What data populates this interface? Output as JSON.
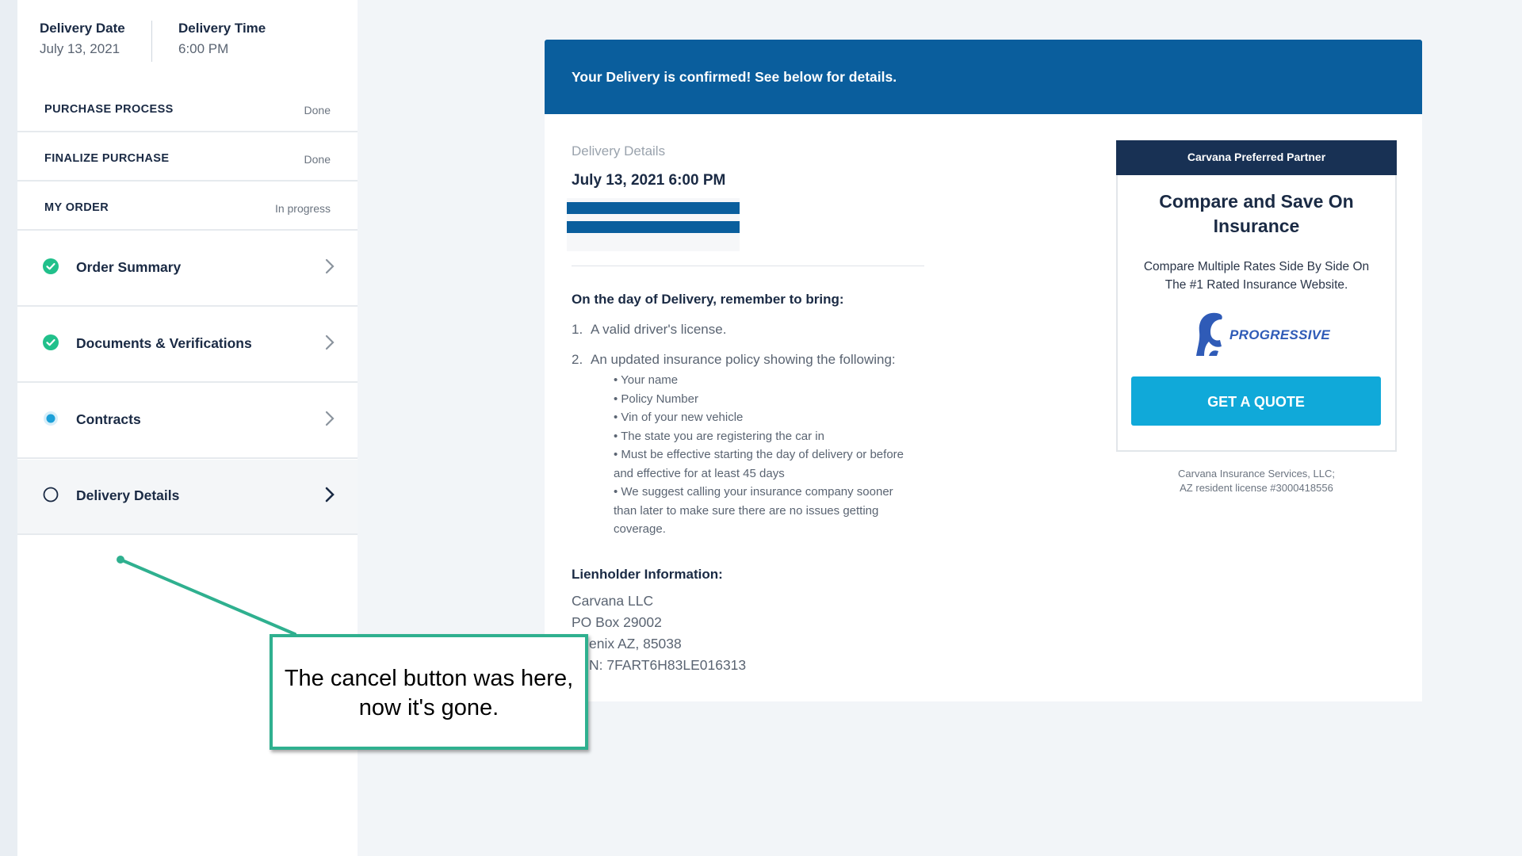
{
  "sidebar": {
    "delivery_date_label": "Delivery Date",
    "delivery_date_value": "July 13, 2021",
    "delivery_time_label": "Delivery Time",
    "delivery_time_value": "6:00 PM",
    "steps": [
      {
        "label": "PURCHASE PROCESS",
        "status": "Done"
      },
      {
        "label": "FINALIZE PURCHASE",
        "status": "Done"
      },
      {
        "label": "MY ORDER",
        "status": "In progress"
      }
    ],
    "substeps": [
      {
        "label": "Order Summary",
        "state": "complete"
      },
      {
        "label": "Documents & Verifications",
        "state": "complete"
      },
      {
        "label": "Contracts",
        "state": "current"
      },
      {
        "label": "Delivery Details",
        "state": "pending"
      }
    ]
  },
  "banner": {
    "text": "Your Delivery is confirmed! See below for details."
  },
  "details": {
    "label": "Delivery Details",
    "datetime": "July 13, 2021 6:00 PM",
    "bring_heading": "On the day of Delivery, remember to bring:",
    "items": [
      {
        "num": "1.",
        "text": "A valid driver's license."
      },
      {
        "num": "2.",
        "text": "An updated insurance policy showing the following:"
      }
    ],
    "bullets": [
      "• Your name",
      "• Policy Number",
      "• Vin of your new vehicle",
      "• The state you are registering the car in",
      "• Must be effective starting the day of delivery or before and effective for at least 45 days",
      "• We suggest calling your insurance company sooner than later to make sure there are no issues getting coverage."
    ],
    "lien_heading": "Lienholder Information:",
    "lien_lines": [
      "Carvana LLC",
      "PO Box 29002",
      "enix AZ, 85038",
      "N: 7FART6H83LE016313"
    ]
  },
  "partner": {
    "header": "Carvana Preferred Partner",
    "title": "Compare and Save On Insurance",
    "description": "Compare Multiple Rates Side By Side On The #1 Rated Insurance Website.",
    "logo_text": "PROGRESSIVE",
    "button": "GET A QUOTE",
    "license_line1": "Carvana Insurance Services, LLC;",
    "license_line2": "AZ resident license #3000418556"
  },
  "callout": {
    "text": "The cancel button was here, now it's gone."
  },
  "colors": {
    "brand_blue": "#0a5e9d",
    "navy": "#183154",
    "cta": "#10a9d9",
    "success": "#21c08b",
    "callout_border": "#2fb08f"
  }
}
